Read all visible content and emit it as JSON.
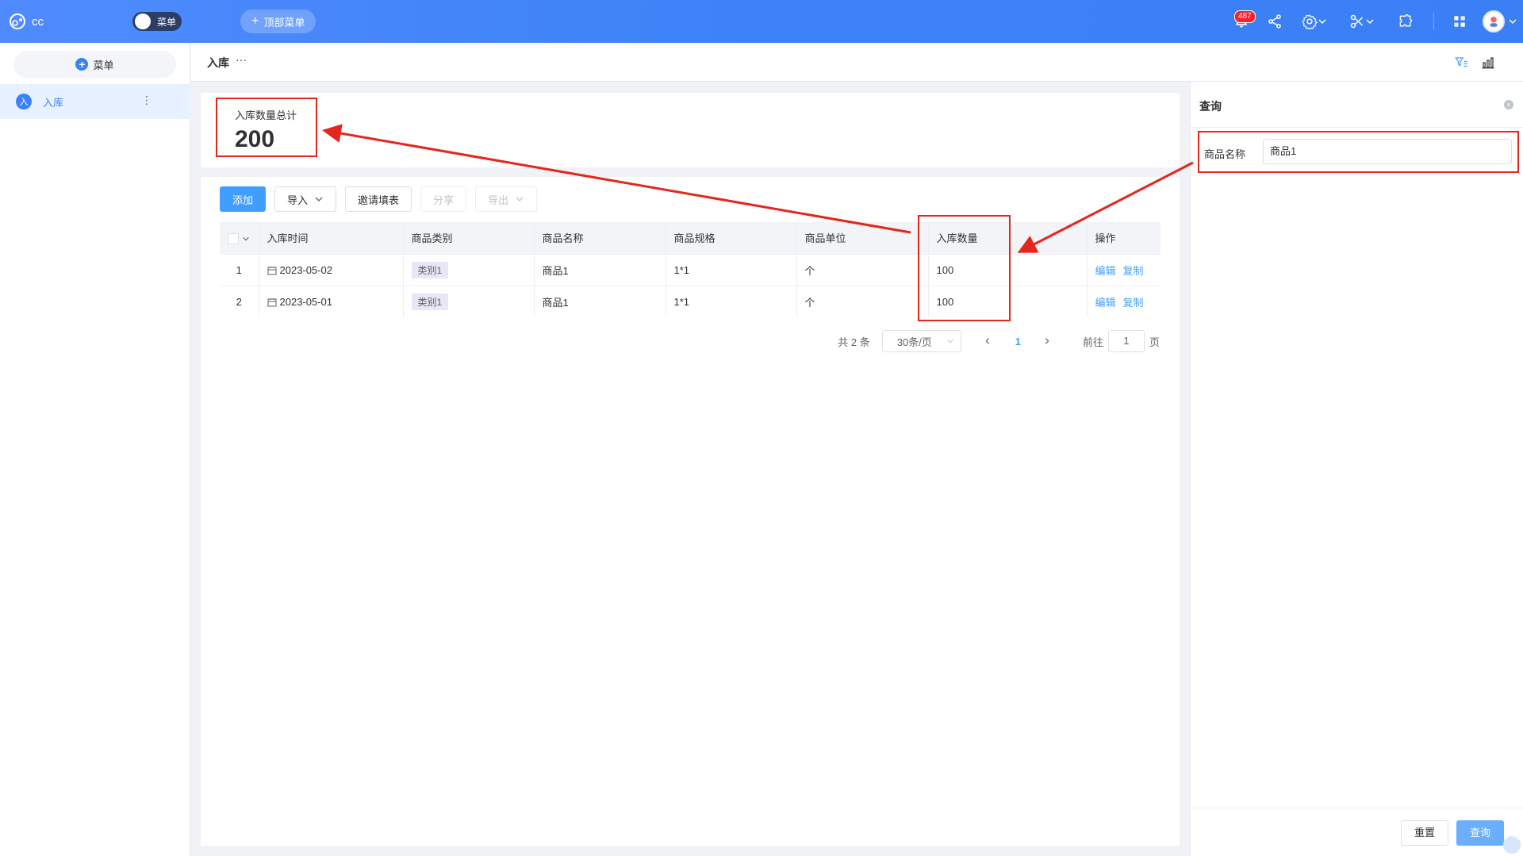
{
  "topbar": {
    "app_name": "cc",
    "menu_toggle_label": "菜单",
    "top_menu_label": "顶部菜单",
    "notification_count": "487"
  },
  "sidebar": {
    "add_menu_label": "菜单",
    "items": [
      {
        "icon_text": "入",
        "label": "入库"
      }
    ]
  },
  "page": {
    "title": "入库",
    "title_more": "···"
  },
  "stat": {
    "label": "入库数量总计",
    "value": "200"
  },
  "toolbar": {
    "add": "添加",
    "import": "导入",
    "invite": "邀请填表",
    "share": "分享",
    "export": "导出"
  },
  "table": {
    "columns": [
      "入库时间",
      "商品类别",
      "商品名称",
      "商品规格",
      "商品单位",
      "入库数量",
      "操作"
    ],
    "rows": [
      {
        "index": "1",
        "date": "2023-05-02",
        "category": "类别1",
        "name": "商品1",
        "spec": "1*1",
        "unit": "个",
        "qty": "100",
        "edit": "编辑",
        "copy": "复制"
      },
      {
        "index": "2",
        "date": "2023-05-01",
        "category": "类别1",
        "name": "商品1",
        "spec": "1*1",
        "unit": "个",
        "qty": "100",
        "edit": "编辑",
        "copy": "复制"
      }
    ]
  },
  "pager": {
    "total": "共 2 条",
    "page_size": "30条/页",
    "current": "1",
    "goto_label": "前往",
    "goto_value": "1",
    "page_suffix": "页"
  },
  "query_panel": {
    "title": "查询",
    "field_label": "商品名称",
    "field_value": "商品1",
    "reset": "重置",
    "search": "查询"
  },
  "colors": {
    "primary": "#409eff",
    "topbar": "#3b82f6",
    "annotation": "#e5261c"
  }
}
